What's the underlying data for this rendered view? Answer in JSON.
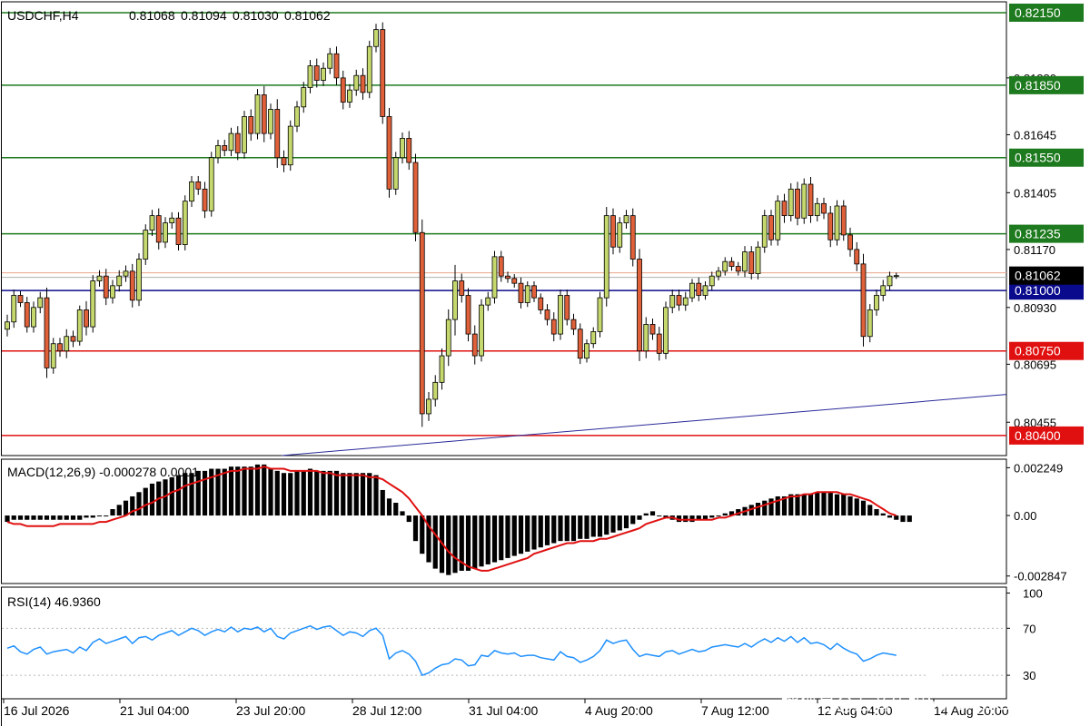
{
  "chart_data": [
    {
      "type": "candlestick",
      "symbol_label": "USDCHF,H4",
      "ohlc_readout": [
        "0.81068",
        "0.81094",
        "0.81030",
        "0.81062"
      ],
      "ylim": [
        0.80317,
        0.82195
      ],
      "price_ticks": [
        "0.81880",
        "0.81645",
        "0.81405",
        "0.81170",
        "0.80930",
        "0.80695",
        "0.80455"
      ],
      "x_ticks": [
        "16 Jul 2026",
        "21 Jul 04:00",
        "23 Jul 20:00",
        "28 Jul 12:00",
        "31 Jul 04:00",
        "4 Aug 20:00",
        "7 Aug 12:00",
        "12 Aug 04:00",
        "14 Aug 20:00"
      ],
      "levels": [
        {
          "value": 0.8215,
          "label": "0.82150",
          "color": "#1e7a1e"
        },
        {
          "value": 0.8185,
          "label": "0.81850",
          "color": "#1e7a1e"
        },
        {
          "value": 0.8155,
          "label": "0.81550",
          "color": "#1e7a1e"
        },
        {
          "value": 0.81235,
          "label": "0.81235",
          "color": "#1e7a1e"
        },
        {
          "value": 0.81,
          "label": "0.81000",
          "color": "#0a0a8c"
        },
        {
          "value": 0.8075,
          "label": "0.80750",
          "color": "#e01010"
        },
        {
          "value": 0.804,
          "label": "0.80400",
          "color": "#e01010"
        }
      ],
      "current_price": {
        "value": 0.81062,
        "label": "0.81062"
      },
      "trendline": {
        "from": [
          0.802,
          0.80317
        ],
        "to": [
          0.8057,
          0.8057
        ]
      },
      "colors": {
        "up": "#c5d86d",
        "down": "#e0603a",
        "level_support": "#e01010",
        "level_resistance": "#1e7a1e",
        "level_mid": "#0a0a8c"
      },
      "closes": [
        0.8087,
        0.8098,
        0.8095,
        0.8085,
        0.8093,
        0.8097,
        0.8068,
        0.8078,
        0.8075,
        0.8081,
        0.8079,
        0.8092,
        0.8085,
        0.8104,
        0.8106,
        0.8097,
        0.8102,
        0.8106,
        0.8108,
        0.8096,
        0.8113,
        0.8125,
        0.8131,
        0.812,
        0.8128,
        0.813,
        0.8119,
        0.8137,
        0.8145,
        0.8142,
        0.8133,
        0.8155,
        0.816,
        0.8158,
        0.8165,
        0.8157,
        0.8172,
        0.8165,
        0.8181,
        0.8165,
        0.8175,
        0.8155,
        0.8152,
        0.8168,
        0.8176,
        0.8184,
        0.8193,
        0.8187,
        0.8192,
        0.8198,
        0.8188,
        0.8178,
        0.8183,
        0.8189,
        0.8182,
        0.8201,
        0.8208,
        0.8172,
        0.8142,
        0.8155,
        0.8163,
        0.8153,
        0.8124,
        0.8049,
        0.8055,
        0.8062,
        0.8073,
        0.8088,
        0.8104,
        0.8098,
        0.8082,
        0.8073,
        0.8094,
        0.8097,
        0.8114,
        0.8106,
        0.8105,
        0.8103,
        0.8095,
        0.8102,
        0.8097,
        0.8092,
        0.8088,
        0.8082,
        0.8098,
        0.8088,
        0.8084,
        0.8072,
        0.8078,
        0.8083,
        0.8097,
        0.8131,
        0.8118,
        0.8128,
        0.8131,
        0.8113,
        0.8075,
        0.8086,
        0.8082,
        0.8074,
        0.8093,
        0.8098,
        0.8094,
        0.8097,
        0.8103,
        0.8098,
        0.8102,
        0.8106,
        0.8108,
        0.8112,
        0.811,
        0.8108,
        0.8116,
        0.8107,
        0.8118,
        0.8131,
        0.8121,
        0.8137,
        0.8131,
        0.8142,
        0.813,
        0.8144,
        0.8131,
        0.8136,
        0.8132,
        0.8121,
        0.8135,
        0.8123,
        0.8117,
        0.8111,
        0.8081,
        0.8092,
        0.8098,
        0.8102,
        0.8106,
        0.81062
      ],
      "volatility": [
        0.0005,
        0.0004,
        0.0003,
        0.0004,
        0.0004,
        0.0004,
        0.0007,
        0.0004,
        0.0004,
        0.0005,
        0.0004,
        0.0003,
        0.0006,
        0.0004,
        0.0004,
        0.0005,
        0.0004,
        0.0004,
        0.0004,
        0.0005,
        0.0004,
        0.0004,
        0.0004,
        0.0005,
        0.0004,
        0.0004,
        0.0004,
        0.0004,
        0.0004,
        0.0004,
        0.0005,
        0.0004,
        0.0004,
        0.0004,
        0.0004,
        0.0005,
        0.0004,
        0.0005,
        0.0004,
        0.0006,
        0.0004,
        0.0007,
        0.0005,
        0.0004,
        0.0004,
        0.0004,
        0.0004,
        0.0005,
        0.0004,
        0.0004,
        0.0005,
        0.0005,
        0.0004,
        0.0004,
        0.0005,
        0.0004,
        0.0004,
        0.0005,
        0.0006,
        0.0004,
        0.0004,
        0.0005,
        0.0006,
        0.0009,
        0.0005,
        0.0005,
        0.0005,
        0.0007,
        0.0011,
        0.0005,
        0.0005,
        0.0006,
        0.0004,
        0.0004,
        0.0004,
        0.0004,
        0.0003,
        0.0003,
        0.0004,
        0.0003,
        0.0003,
        0.0003,
        0.0004,
        0.0005,
        0.0004,
        0.0004,
        0.0004,
        0.0004,
        0.0003,
        0.0003,
        0.0004,
        0.0006,
        0.0005,
        0.0004,
        0.0004,
        0.0005,
        0.0007,
        0.0005,
        0.0004,
        0.0005,
        0.0004,
        0.0004,
        0.0004,
        0.0004,
        0.0003,
        0.0004,
        0.0003,
        0.0003,
        0.0003,
        0.0003,
        0.0003,
        0.0003,
        0.0004,
        0.0004,
        0.0004,
        0.0004,
        0.0004,
        0.0004,
        0.0005,
        0.0004,
        0.0005,
        0.0004,
        0.0005,
        0.0004,
        0.0004,
        0.0005,
        0.0004,
        0.0004,
        0.0005,
        0.0005,
        0.0007,
        0.0004,
        0.0004,
        0.0004,
        0.0003,
        0.0002
      ]
    },
    {
      "type": "bar",
      "label": "MACD(12,26,9) -0.000278 0.0001",
      "ylim": [
        -0.0032,
        0.00265
      ],
      "ticks": [
        {
          "value": 0.002249,
          "label": "0.002249"
        },
        {
          "value": 0.0,
          "label": "0.00"
        },
        {
          "value": -0.002847,
          "label": "-0.002847"
        }
      ],
      "histogram": [
        -0.0003,
        -0.0002,
        -0.0002,
        -0.0002,
        -0.0002,
        -0.0002,
        -0.0002,
        -0.0002,
        -0.0002,
        -0.0002,
        -0.0002,
        -0.0002,
        -0.0001,
        -0.0001,
        0.0,
        0.0,
        0.0003,
        0.0005,
        0.0007,
        0.0009,
        0.0011,
        0.0013,
        0.0015,
        0.0016,
        0.0017,
        0.0018,
        0.0019,
        0.002,
        0.002,
        0.0021,
        0.0021,
        0.0022,
        0.0022,
        0.0022,
        0.0023,
        0.0023,
        0.0023,
        0.0023,
        0.0024,
        0.0024,
        0.0022,
        0.0021,
        0.002,
        0.002,
        0.0021,
        0.0021,
        0.0022,
        0.0021,
        0.0021,
        0.0021,
        0.0021,
        0.002,
        0.002,
        0.002,
        0.002,
        0.002,
        0.0019,
        0.0012,
        0.0008,
        0.0006,
        0.0002,
        -0.0003,
        -0.0012,
        -0.0018,
        -0.0022,
        -0.0025,
        -0.0027,
        -0.0028,
        -0.0027,
        -0.0026,
        -0.0026,
        -0.0025,
        -0.0024,
        -0.0023,
        -0.0022,
        -0.0021,
        -0.002,
        -0.0019,
        -0.0018,
        -0.0017,
        -0.0016,
        -0.0015,
        -0.0014,
        -0.0013,
        -0.0012,
        -0.0012,
        -0.0012,
        -0.0011,
        -0.0011,
        -0.001,
        -0.001,
        -0.0009,
        -0.0008,
        -0.0007,
        -0.0006,
        -0.0004,
        -0.0002,
        0.0001,
        0.0002,
        0.0,
        -0.0001,
        -0.0002,
        -0.0003,
        -0.0003,
        -0.0003,
        -0.0002,
        -0.0002,
        -0.0001,
        0.0,
        0.0001,
        0.0002,
        0.0003,
        0.0004,
        0.0005,
        0.0006,
        0.0007,
        0.0008,
        0.0009,
        0.0009,
        0.001,
        0.001,
        0.001,
        0.001,
        0.0011,
        0.0011,
        0.0011,
        0.001,
        0.001,
        0.0009,
        0.0008,
        0.0007,
        0.0005,
        0.0003,
        0.0001,
        -0.0001,
        -0.0002,
        -0.0003,
        -0.0003
      ],
      "signal": [
        -0.0003,
        -0.0004,
        -0.0004,
        -0.0005,
        -0.0005,
        -0.0005,
        -0.0005,
        -0.0005,
        -0.0004,
        -0.0004,
        -0.0004,
        -0.0004,
        -0.0004,
        -0.0004,
        -0.0003,
        -0.0003,
        -0.0002,
        -0.0001,
        0.0,
        0.0002,
        0.0003,
        0.0005,
        0.0006,
        0.0008,
        0.0009,
        0.0011,
        0.0012,
        0.0014,
        0.0015,
        0.0016,
        0.0017,
        0.0018,
        0.0019,
        0.002,
        0.0021,
        0.0021,
        0.0022,
        0.0022,
        0.0022,
        0.0023,
        0.0022,
        0.0022,
        0.0022,
        0.0021,
        0.0021,
        0.0021,
        0.0021,
        0.0021,
        0.002,
        0.002,
        0.0019,
        0.0019,
        0.0019,
        0.0019,
        0.0019,
        0.0018,
        0.0018,
        0.0017,
        0.0015,
        0.0013,
        0.0011,
        0.0008,
        0.0004,
        0.0,
        -0.0005,
        -0.0009,
        -0.0013,
        -0.0017,
        -0.002,
        -0.0022,
        -0.0024,
        -0.0025,
        -0.0026,
        -0.0026,
        -0.0025,
        -0.0024,
        -0.0023,
        -0.0022,
        -0.0021,
        -0.002,
        -0.0018,
        -0.0017,
        -0.0016,
        -0.0015,
        -0.0014,
        -0.0013,
        -0.0013,
        -0.0012,
        -0.0012,
        -0.0012,
        -0.0011,
        -0.0011,
        -0.001,
        -0.0009,
        -0.0008,
        -0.0007,
        -0.0006,
        -0.0004,
        -0.0003,
        -0.0002,
        -0.0001,
        -0.0001,
        -0.0002,
        -0.0002,
        -0.0002,
        -0.0002,
        -0.0002,
        -0.0002,
        -0.0001,
        -0.0001,
        0.0,
        0.0001,
        0.0002,
        0.0003,
        0.0004,
        0.0005,
        0.0006,
        0.0007,
        0.0008,
        0.0009,
        0.0009,
        0.001,
        0.001,
        0.0011,
        0.0011,
        0.0011,
        0.0011,
        0.001,
        0.001,
        0.0009,
        0.0008,
        0.0007,
        0.0005,
        0.0003,
        0.0001,
        0.0
      ]
    },
    {
      "type": "line",
      "label": "RSI(14) 46.9360",
      "ylim": [
        10,
        105
      ],
      "ticks": [
        {
          "value": 100,
          "label": "100"
        },
        {
          "value": 70,
          "label": "70"
        },
        {
          "value": 30,
          "label": "30"
        }
      ],
      "values": [
        53,
        55,
        50,
        48,
        52,
        54,
        48,
        50,
        51,
        52,
        49,
        54,
        51,
        58,
        61,
        57,
        59,
        61,
        63,
        57,
        62,
        63,
        60,
        64,
        66,
        68,
        64,
        67,
        70,
        68,
        64,
        67,
        69,
        67,
        71,
        67,
        70,
        69,
        71,
        67,
        70,
        63,
        61,
        66,
        68,
        70,
        72,
        69,
        71,
        72,
        68,
        64,
        67,
        66,
        63,
        68,
        70,
        64,
        44,
        49,
        51,
        48,
        42,
        30,
        32,
        36,
        39,
        40,
        44,
        43,
        38,
        39,
        47,
        46,
        51,
        49,
        48,
        49,
        46,
        47,
        47,
        45,
        44,
        43,
        50,
        46,
        45,
        41,
        43,
        46,
        51,
        60,
        57,
        59,
        60,
        52,
        46,
        48,
        47,
        46,
        50,
        51,
        48,
        50,
        52,
        50,
        51,
        54,
        55,
        56,
        55,
        54,
        57,
        54,
        58,
        61,
        58,
        62,
        59,
        63,
        58,
        62,
        57,
        58,
        56,
        52,
        57,
        53,
        50,
        48,
        42,
        44,
        47,
        49,
        48,
        47
      ]
    }
  ],
  "watermark": {
    "brand": "老虎社区",
    "source": "搜狐号@汇商传媒Forexpress"
  }
}
